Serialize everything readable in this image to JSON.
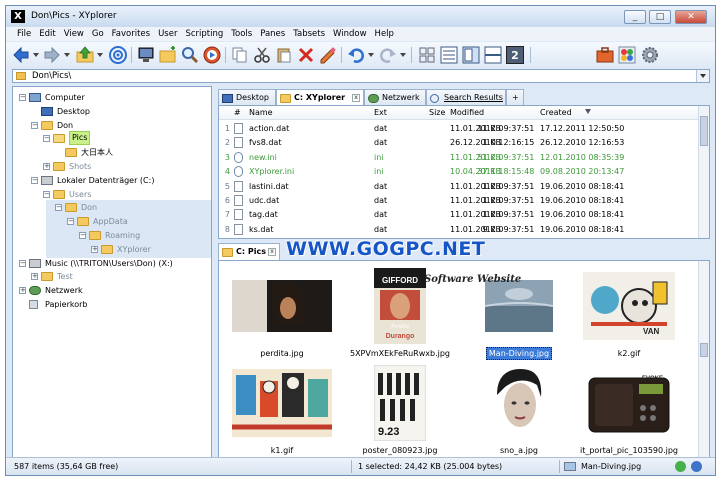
{
  "window": {
    "title": "Don\\Pics - XYplorer",
    "app_letter": "X",
    "minimize": "_",
    "maximize": "□",
    "close": "✕"
  },
  "menu": [
    "File",
    "Edit",
    "View",
    "Go",
    "Favorites",
    "User",
    "Scripting",
    "Tools",
    "Panes",
    "Tabsets",
    "Window",
    "Help"
  ],
  "toolbar": {
    "icons": [
      "back-arrow-icon",
      "forward-arrow-icon",
      "up-folder-icon",
      "target-icon",
      "computer-icon",
      "new-folder-icon",
      "find-icon",
      "refresh-icon",
      "copy-icon",
      "cut-icon",
      "paste-icon",
      "delete-icon",
      "rename-icon",
      "undo-icon",
      "redo-icon",
      "grid-icon",
      "details-icon",
      "preview-pane-icon",
      "dual-pane-icon",
      "pane-2-icon",
      "toolbox-icon",
      "settings-icon",
      "gear-icon"
    ],
    "pane_number": "2"
  },
  "address": {
    "path": "Don\\Pics\\"
  },
  "tree": [
    {
      "label": "Computer",
      "icon": "computer-icon",
      "depth": 0,
      "expander": "−"
    },
    {
      "label": "Desktop",
      "icon": "desktop-icon",
      "depth": 1,
      "expander": ""
    },
    {
      "label": "Don",
      "icon": "folder-icon",
      "depth": 1,
      "expander": "−"
    },
    {
      "label": "Pics",
      "icon": "folder-open-icon",
      "depth": 2,
      "expander": "−",
      "highlight": true
    },
    {
      "label": "大日本人",
      "icon": "folder-icon",
      "depth": 3,
      "expander": ""
    },
    {
      "label": "Shots",
      "icon": "folder-icon",
      "depth": 2,
      "expander": "+",
      "gray": true
    },
    {
      "label": "Lokaler Datenträger (C:)",
      "icon": "drive-icon",
      "depth": 1,
      "expander": "−"
    },
    {
      "label": "Users",
      "icon": "folder-icon",
      "depth": 2,
      "expander": "−",
      "gray": true
    },
    {
      "label": "Don",
      "icon": "folder-icon",
      "depth": 3,
      "expander": "−",
      "gray": true
    },
    {
      "label": "AppData",
      "icon": "folder-icon",
      "depth": 4,
      "expander": "−",
      "gray": true
    },
    {
      "label": "Roaming",
      "icon": "folder-icon",
      "depth": 5,
      "expander": "−",
      "gray": true
    },
    {
      "label": "XYplorer",
      "icon": "folder-icon",
      "depth": 6,
      "expander": "+",
      "gray": true
    },
    {
      "label": "Music (\\\\TRITON\\Users\\Don) (X:)",
      "icon": "network-drive-icon",
      "depth": 0,
      "expander": "−"
    },
    {
      "label": "Test",
      "icon": "folder-icon",
      "depth": 1,
      "expander": "+",
      "gray": true
    },
    {
      "label": "Netzwerk",
      "icon": "network-icon",
      "depth": 0,
      "expander": "+"
    },
    {
      "label": "Papierkorb",
      "icon": "recycle-bin-icon",
      "depth": 0,
      "expander": ""
    }
  ],
  "tabs_top": [
    {
      "label": "Desktop",
      "icon": "desktop-icon"
    },
    {
      "label": "C: XYplorer",
      "icon": "folder-icon",
      "active": true
    },
    {
      "label": "Netzwerk",
      "icon": "network-icon"
    },
    {
      "label": "Search Results",
      "icon": "search-icon"
    },
    {
      "label": "+",
      "icon": ""
    }
  ],
  "list_headers": {
    "num": "#",
    "name": "Name",
    "ext": "Ext",
    "size": "Size",
    "modified": "Modified",
    "created": "Created"
  },
  "files": [
    {
      "num": "1",
      "name": "action.dat",
      "ext": "dat",
      "size": "11 KB",
      "modified": "11.01.2012 09:37:51",
      "created": "17.12.2011 12:50:50"
    },
    {
      "num": "2",
      "name": "fvs8.dat",
      "ext": "dat",
      "size": "1 KB",
      "modified": "26.12.2010 12:16:15",
      "created": "26.12.2010 12:16:53"
    },
    {
      "num": "3",
      "name": "new.ini",
      "ext": "ini",
      "size": "51 KB",
      "modified": "11.01.2012 09:37:51",
      "created": "12.01.2010 08:35:39",
      "green": true
    },
    {
      "num": "4",
      "name": "XYplorer.ini",
      "ext": "ini",
      "size": "37 KB",
      "modified": "10.04.2011 18:15:48",
      "created": "09.08.2010 20:13:47",
      "green": true
    },
    {
      "num": "5",
      "name": "lastini.dat",
      "ext": "dat",
      "size": "1 KB",
      "modified": "11.01.2012 09:37:51",
      "created": "19.06.2010 08:18:41"
    },
    {
      "num": "6",
      "name": "udc.dat",
      "ext": "dat",
      "size": "1 KB",
      "modified": "11.01.2012 09:37:51",
      "created": "19.06.2010 08:18:41"
    },
    {
      "num": "7",
      "name": "tag.dat",
      "ext": "dat",
      "size": "1 KB",
      "modified": "11.01.2012 09:37:51",
      "created": "19.06.2010 08:18:41"
    },
    {
      "num": "8",
      "name": "ks.dat",
      "ext": "dat",
      "size": "9 KB",
      "modified": "11.01.2012 09:37:51",
      "created": "19.06.2010 08:18:41"
    }
  ],
  "tabs_bottom": [
    {
      "label": "C: Pics",
      "icon": "folder-icon",
      "active": true
    }
  ],
  "watermark": {
    "site": "WWW.GOGPC.NET",
    "tagline": "Software Website"
  },
  "thumbnails": [
    {
      "caption": "perdita.jpg",
      "kind": "photo-dark"
    },
    {
      "caption": "5XPVmXEkFeRuRwxb.jpg",
      "kind": "poster",
      "poster_top": "GIFFORD",
      "poster_bottom": "Perdita Durango"
    },
    {
      "caption": "Man-Diving.jpg",
      "kind": "photo-sea",
      "selected": true
    },
    {
      "caption": "k2.gif",
      "kind": "illustration"
    },
    {
      "caption": "k1.gif",
      "kind": "illustration-2"
    },
    {
      "caption": "poster_080923.jpg",
      "kind": "poster-figures",
      "poster_date": "9.23"
    },
    {
      "caption": "sno_a.jpg",
      "kind": "portrait"
    },
    {
      "caption": "it_portal_pic_103590.jpg",
      "kind": "radio",
      "radio_brand": "EVOKE"
    }
  ],
  "status": {
    "items": "587 items (35,64 GB free)",
    "selected": "1 selected: 24,42 KB (25.004 bytes)",
    "file": "Man-Diving.jpg"
  },
  "colors": {
    "accent": "#3d7bd9",
    "watermark": "#1655c6",
    "highlight": "#c9f08a",
    "green_text": "#3e9a3a"
  }
}
